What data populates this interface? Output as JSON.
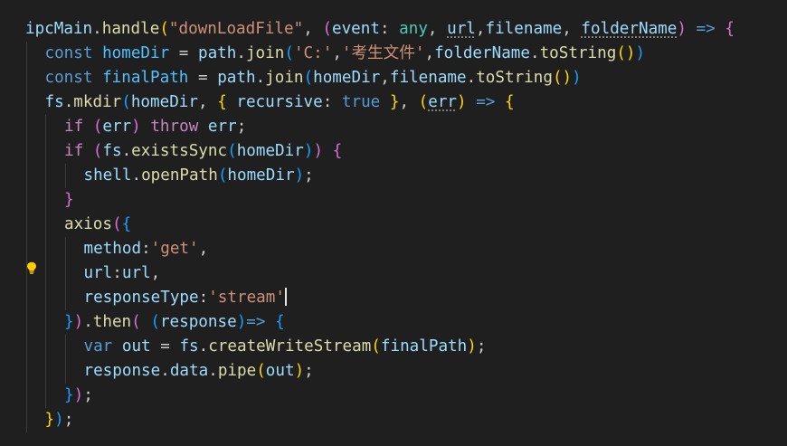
{
  "editor": {
    "theme_colors": {
      "background": "#1f1f1f",
      "function": "#dcdcaa",
      "variable": "#9cdcfe",
      "constant": "#4fc1ff",
      "keyword": "#569cd6",
      "control": "#c586c0",
      "string": "#ce9178",
      "type": "#4ec9b0",
      "punctuation": "#cccccc",
      "bracket_level_1": "#ffd700",
      "bracket_level_2": "#da70d6",
      "bracket_level_3": "#179fff"
    },
    "lightbulb_icon": "lightbulb-icon",
    "cursor_line": 11,
    "lines": [
      {
        "indent": 0,
        "tokens": [
          [
            "ipcMain",
            "var"
          ],
          [
            ".",
            "p"
          ],
          [
            "handle",
            "func"
          ],
          [
            "(",
            "b1"
          ],
          [
            "\"downLoadFile\"",
            "str"
          ],
          [
            ", ",
            "p"
          ],
          [
            "(",
            "b2"
          ],
          [
            "event",
            "var"
          ],
          [
            ": ",
            "p"
          ],
          [
            "any",
            "type"
          ],
          [
            ", ",
            "p"
          ],
          [
            "url",
            "var",
            "u"
          ],
          [
            ",",
            "p"
          ],
          [
            "filename",
            "var"
          ],
          [
            ", ",
            "p"
          ],
          [
            "folderName",
            "var",
            "u"
          ],
          [
            ")",
            "b2"
          ],
          [
            " ",
            "p"
          ],
          [
            "=>",
            "kw"
          ],
          [
            " ",
            "p"
          ],
          [
            "{",
            "b2"
          ]
        ]
      },
      {
        "indent": 1,
        "tokens": [
          [
            "const",
            "kw"
          ],
          [
            " ",
            "p"
          ],
          [
            "homeDir",
            "const"
          ],
          [
            " = ",
            "p"
          ],
          [
            "path",
            "var"
          ],
          [
            ".",
            "p"
          ],
          [
            "join",
            "func"
          ],
          [
            "(",
            "b3"
          ],
          [
            "'C:'",
            "str"
          ],
          [
            ",",
            "p"
          ],
          [
            "'考生文件'",
            "str"
          ],
          [
            ",",
            "p"
          ],
          [
            "folderName",
            "var"
          ],
          [
            ".",
            "p"
          ],
          [
            "toString",
            "func"
          ],
          [
            "()",
            "b1"
          ],
          [
            ")",
            "b3"
          ]
        ]
      },
      {
        "indent": 1,
        "tokens": [
          [
            "const",
            "kw"
          ],
          [
            " ",
            "p"
          ],
          [
            "finalPath",
            "const"
          ],
          [
            " = ",
            "p"
          ],
          [
            "path",
            "var"
          ],
          [
            ".",
            "p"
          ],
          [
            "join",
            "func"
          ],
          [
            "(",
            "b3"
          ],
          [
            "homeDir",
            "var"
          ],
          [
            ",",
            "p"
          ],
          [
            "filename",
            "var"
          ],
          [
            ".",
            "p"
          ],
          [
            "toString",
            "func"
          ],
          [
            "()",
            "b1"
          ],
          [
            ")",
            "b3"
          ]
        ]
      },
      {
        "indent": 1,
        "tokens": [
          [
            "fs",
            "var"
          ],
          [
            ".",
            "p"
          ],
          [
            "mkdir",
            "func"
          ],
          [
            "(",
            "b3"
          ],
          [
            "homeDir",
            "var"
          ],
          [
            ", ",
            "p"
          ],
          [
            "{",
            "b1"
          ],
          [
            " ",
            "p"
          ],
          [
            "recursive",
            "var"
          ],
          [
            ": ",
            "p"
          ],
          [
            "true",
            "kw"
          ],
          [
            " ",
            "p"
          ],
          [
            "}",
            "b1"
          ],
          [
            ", ",
            "p"
          ],
          [
            "(",
            "b1"
          ],
          [
            "err",
            "var",
            "u"
          ],
          [
            ")",
            "b1"
          ],
          [
            " ",
            "p"
          ],
          [
            "=>",
            "kw"
          ],
          [
            " ",
            "p"
          ],
          [
            "{",
            "b1"
          ]
        ]
      },
      {
        "indent": 2,
        "tokens": [
          [
            "if",
            "ctrl"
          ],
          [
            " ",
            "p"
          ],
          [
            "(",
            "b2"
          ],
          [
            "err",
            "var"
          ],
          [
            ")",
            "b2"
          ],
          [
            " ",
            "p"
          ],
          [
            "throw",
            "ctrl"
          ],
          [
            " ",
            "p"
          ],
          [
            "err",
            "var"
          ],
          [
            ";",
            "p"
          ]
        ]
      },
      {
        "indent": 2,
        "tokens": [
          [
            "if",
            "ctrl"
          ],
          [
            " ",
            "p"
          ],
          [
            "(",
            "b2"
          ],
          [
            "fs",
            "var"
          ],
          [
            ".",
            "p"
          ],
          [
            "existsSync",
            "func"
          ],
          [
            "(",
            "b3"
          ],
          [
            "homeDir",
            "var"
          ],
          [
            ")",
            "b3"
          ],
          [
            ")",
            "b2"
          ],
          [
            " ",
            "p"
          ],
          [
            "{",
            "b2"
          ]
        ]
      },
      {
        "indent": 3,
        "tokens": [
          [
            "shell",
            "var"
          ],
          [
            ".",
            "p"
          ],
          [
            "openPath",
            "func"
          ],
          [
            "(",
            "b3"
          ],
          [
            "homeDir",
            "var"
          ],
          [
            ")",
            "b3"
          ],
          [
            ";",
            "p"
          ]
        ]
      },
      {
        "indent": 2,
        "tokens": [
          [
            "}",
            "b2"
          ]
        ]
      },
      {
        "indent": 2,
        "tokens": [
          [
            "axios",
            "func"
          ],
          [
            "(",
            "b2"
          ],
          [
            "{",
            "b3"
          ]
        ]
      },
      {
        "indent": 3,
        "tokens": [
          [
            "method",
            "var"
          ],
          [
            ":",
            "p"
          ],
          [
            "'get'",
            "str"
          ],
          [
            ",",
            "p"
          ]
        ]
      },
      {
        "indent": 3,
        "tokens": [
          [
            "url",
            "var"
          ],
          [
            ":",
            "p"
          ],
          [
            "url",
            "var"
          ],
          [
            ",",
            "p"
          ]
        ]
      },
      {
        "indent": 3,
        "tokens": [
          [
            "responseType",
            "var"
          ],
          [
            ":",
            "p"
          ],
          [
            "'stream'",
            "str"
          ]
        ]
      },
      {
        "indent": 2,
        "tokens": [
          [
            "}",
            "b3"
          ],
          [
            ")",
            "b2"
          ],
          [
            ".",
            "p"
          ],
          [
            "then",
            "func"
          ],
          [
            "(",
            "b2"
          ],
          [
            " ",
            "p"
          ],
          [
            "(",
            "b3"
          ],
          [
            "response",
            "var"
          ],
          [
            ")",
            "b3"
          ],
          [
            "=>",
            "kw"
          ],
          [
            " ",
            "p"
          ],
          [
            "{",
            "b3"
          ]
        ]
      },
      {
        "indent": 3,
        "tokens": [
          [
            "var",
            "kw"
          ],
          [
            " ",
            "p"
          ],
          [
            "out",
            "var"
          ],
          [
            " = ",
            "p"
          ],
          [
            "fs",
            "var"
          ],
          [
            ".",
            "p"
          ],
          [
            "createWriteStream",
            "func"
          ],
          [
            "(",
            "b1"
          ],
          [
            "finalPath",
            "var"
          ],
          [
            ")",
            "b1"
          ],
          [
            ";",
            "p"
          ]
        ]
      },
      {
        "indent": 3,
        "tokens": [
          [
            "response",
            "var"
          ],
          [
            ".",
            "p"
          ],
          [
            "data",
            "var"
          ],
          [
            ".",
            "p"
          ],
          [
            "pipe",
            "func"
          ],
          [
            "(",
            "b1"
          ],
          [
            "out",
            "var"
          ],
          [
            ")",
            "b1"
          ],
          [
            ";",
            "p"
          ]
        ]
      },
      {
        "indent": 2,
        "tokens": [
          [
            "}",
            "b3"
          ],
          [
            ")",
            "b2"
          ],
          [
            ";",
            "p"
          ]
        ]
      },
      {
        "indent": 1,
        "tokens": [
          [
            "}",
            "b1"
          ],
          [
            ")",
            "b3"
          ],
          [
            ";",
            "p"
          ]
        ]
      },
      {
        "indent": 0,
        "tokens": []
      }
    ]
  }
}
